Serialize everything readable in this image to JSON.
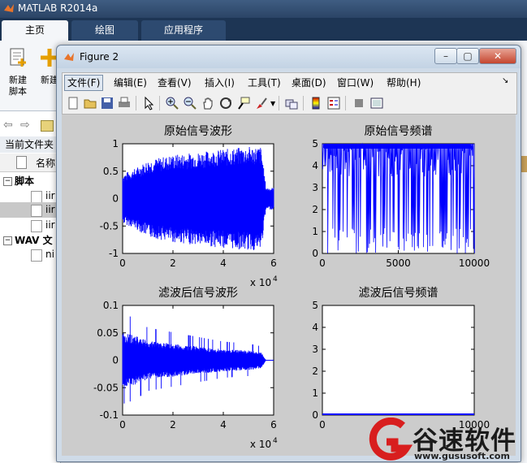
{
  "matlab": {
    "title": "MATLAB R2014a",
    "tabs": [
      "主页",
      "绘图",
      "应用程序"
    ],
    "ribbon": {
      "new_script": "新建\n脚本",
      "new": "新建"
    },
    "current_folder_label": "当前文件夹",
    "name_column": "名称",
    "tree": {
      "scripts_group": "脚本",
      "script_items": [
        "iir",
        "iir",
        "iir"
      ],
      "wav_group": "WAV 文",
      "wav_items": [
        "ni"
      ]
    }
  },
  "figure": {
    "title": "Figure 2",
    "menu": [
      "文件(F)",
      "编辑(E)",
      "查看(V)",
      "插入(I)",
      "工具(T)",
      "桌面(D)",
      "窗口(W)",
      "帮助(H)"
    ],
    "toolbar_icons": [
      "new-figure-icon",
      "open-icon",
      "save-icon",
      "print-icon",
      "pointer-icon",
      "zoom-in-icon",
      "zoom-out-icon",
      "pan-icon",
      "rotate-icon",
      "data-cursor-icon",
      "brush-icon",
      "link-icon",
      "colorbar-icon",
      "legend-icon",
      "hide-plot-tools-icon",
      "show-plot-tools-icon"
    ]
  },
  "chart_data": [
    {
      "type": "line",
      "title": "原始信号波形",
      "x_ticks": [
        "0",
        "2",
        "4",
        "6"
      ],
      "y_ticks": [
        "1",
        "0.5",
        "0",
        "-0.5",
        "-1"
      ],
      "x_exponent": "x 10",
      "x_exponent_power": "4",
      "xlim": [
        0,
        60000
      ],
      "ylim": [
        -1,
        1
      ],
      "color": "#0000ff",
      "series": [
        {
          "envelope_x": [
            0,
            5000,
            10000,
            20000,
            30000,
            40000,
            50000,
            55000,
            57000,
            60000
          ],
          "envelope_y": [
            0.45,
            0.55,
            0.7,
            0.8,
            0.85,
            0.9,
            0.95,
            0.95,
            0.2,
            0.2
          ]
        }
      ]
    },
    {
      "type": "line",
      "title": "原始信号频谱",
      "x_ticks": [
        "0",
        "5000",
        "10000"
      ],
      "y_ticks": [
        "5",
        "4",
        "3",
        "2",
        "1",
        "0"
      ],
      "xlim": [
        0,
        10000
      ],
      "ylim": [
        0,
        5
      ],
      "color": "#0000ff"
    },
    {
      "type": "line",
      "title": "滤波后信号波形",
      "x_ticks": [
        "0",
        "2",
        "4",
        "6"
      ],
      "y_ticks": [
        "0.1",
        "0.05",
        "0",
        "-0.05",
        "-0.1"
      ],
      "x_exponent": "x 10",
      "x_exponent_power": "4",
      "xlim": [
        0,
        60000
      ],
      "ylim": [
        -0.1,
        0.1
      ],
      "color": "#0000ff",
      "series": [
        {
          "envelope_x": [
            0,
            5000,
            10000,
            20000,
            30000,
            40000,
            50000,
            55000,
            57000,
            60000
          ],
          "envelope_y": [
            0.05,
            0.045,
            0.035,
            0.03,
            0.025,
            0.02,
            0.018,
            0.015,
            0,
            0
          ]
        }
      ]
    },
    {
      "type": "line",
      "title": "滤波后信号频谱",
      "x_ticks": [
        "0",
        "10000"
      ],
      "y_ticks": [
        "5",
        "4",
        "3",
        "2",
        "1",
        "0"
      ],
      "xlim": [
        0,
        10000
      ],
      "ylim": [
        0,
        5
      ],
      "color": "#0000ff"
    }
  ],
  "watermark": {
    "text": "谷速软件",
    "url": "www.gususoft.com"
  }
}
